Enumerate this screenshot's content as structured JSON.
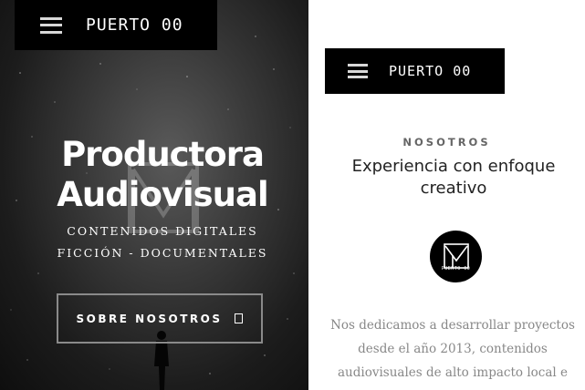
{
  "brand": "PUERTO 00",
  "hero": {
    "title_line1": "Productora",
    "title_line2": "Audiovisual",
    "subtitle_line1": "CONTENIDOS DIGITALES",
    "subtitle_line2": "FICCIÓN - DOCUMENTALES",
    "cta_label": "SOBRE NOSOTROS"
  },
  "about": {
    "kicker": "NOSOTROS",
    "title_line1": "Experiencia con enfoque",
    "title_line2": "creativo",
    "logo_text": "PUERTO 00",
    "body_line1": "Nos dedicamos a desarrollar proyectos",
    "body_line2": "desde el año 2013, contenidos",
    "body_line3": "audiovisuales de alto impacto local e"
  },
  "colors": {
    "bar": "#000000",
    "text_light": "#ffffff",
    "text_muted": "#888888"
  }
}
